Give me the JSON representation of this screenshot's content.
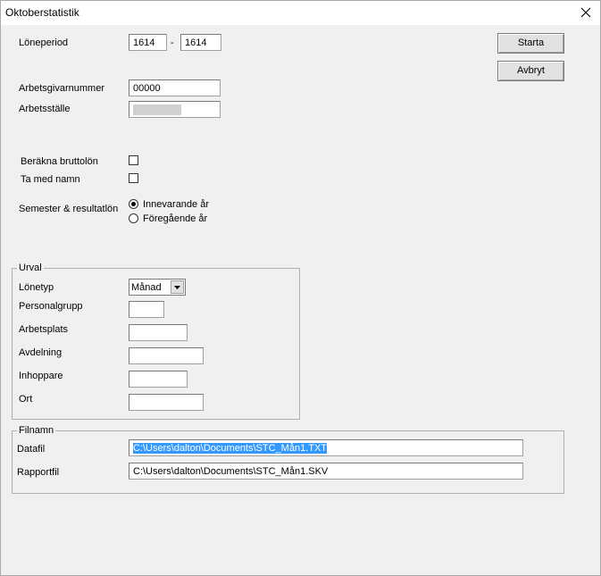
{
  "window": {
    "title": "Oktoberstatistik"
  },
  "icons": {
    "close": "close-icon",
    "dropdown": "chevron-down-icon"
  },
  "loneperiod": {
    "label": "Löneperiod",
    "from": "1614",
    "separator": "-",
    "to": "1614"
  },
  "arbetsgivarnummer": {
    "label": "Arbetsgivarnummer",
    "value": "00000"
  },
  "arbetsstalle": {
    "label": "Arbetsställe",
    "value": ""
  },
  "buttons": {
    "start": "Starta",
    "cancel": "Avbryt"
  },
  "options": {
    "brutto": {
      "label": "Beräkna bruttolön",
      "checked": false
    },
    "namn": {
      "label": "Ta med namn",
      "checked": false
    }
  },
  "semester": {
    "label": "Semester & resultatlön",
    "current": "Innevarande år",
    "previous": "Föregående år",
    "selected": "current"
  },
  "urval": {
    "title": "Urval",
    "lonetyp": {
      "label": "Lönetyp",
      "value": "Månad"
    },
    "personalgrupp": {
      "label": "Personalgrupp",
      "value": ""
    },
    "arbetsplats": {
      "label": "Arbetsplats",
      "value": ""
    },
    "avdelning": {
      "label": "Avdelning",
      "value": ""
    },
    "inhoppare": {
      "label": "Inhoppare",
      "value": ""
    },
    "ort": {
      "label": "Ort",
      "value": ""
    }
  },
  "filnamn": {
    "title": "Filnamn",
    "datafil": {
      "label": "Datafil",
      "value": "C:\\Users\\dalton\\Documents\\STC_Mån1.TXT"
    },
    "rapportfil": {
      "label": "Rapportfil",
      "value": "C:\\Users\\dalton\\Documents\\STC_Mån1.SKV"
    }
  }
}
